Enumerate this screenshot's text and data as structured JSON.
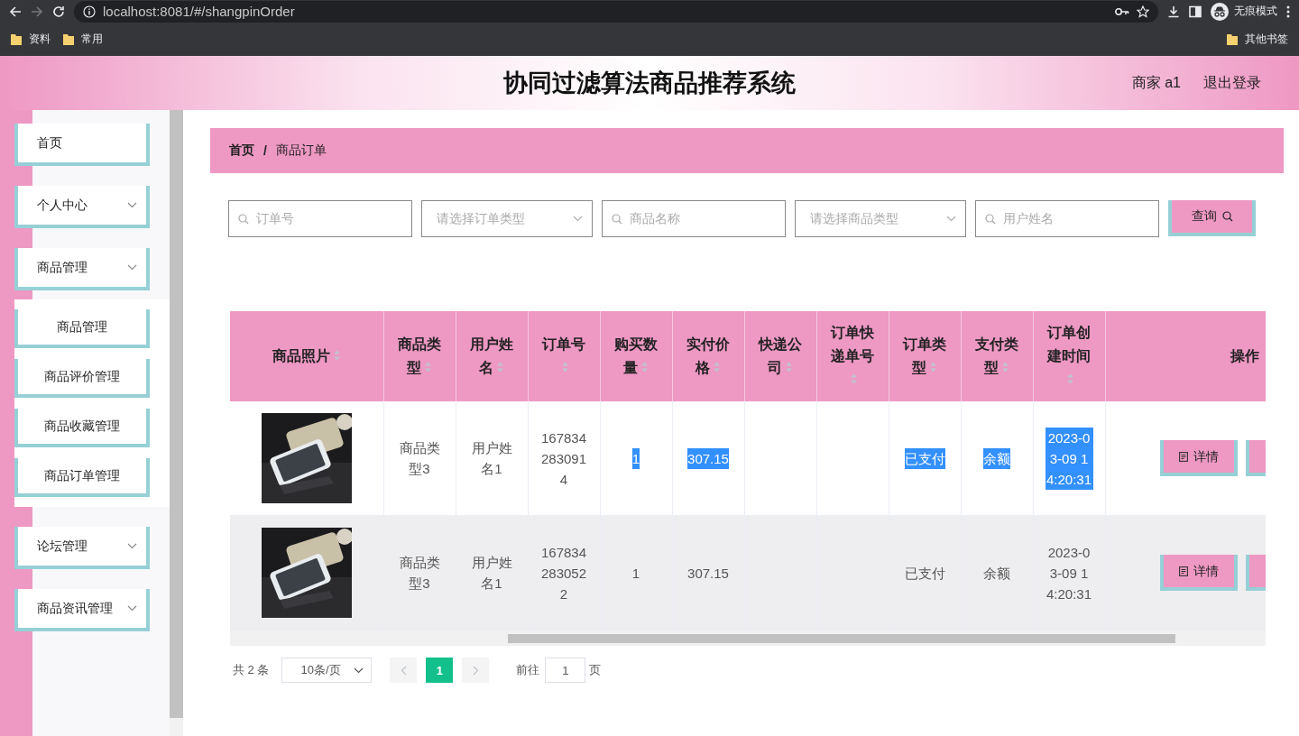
{
  "browser": {
    "url": "localhost:8081/#/shangpinOrder",
    "bookmarks": [
      "资料",
      "常用"
    ],
    "other_bookmarks": "其他书签",
    "profile": "无痕模式"
  },
  "header": {
    "title": "协同过滤算法商品推荐系统",
    "user": "商家 a1",
    "logout": "退出登录"
  },
  "sidebar": {
    "items": [
      {
        "kind": "link",
        "label": "首页"
      },
      {
        "kind": "submenu",
        "label": "个人中心"
      },
      {
        "kind": "submenu",
        "label": "商品管理",
        "children": [
          {
            "label": "商品管理"
          },
          {
            "label": "商品评价管理"
          },
          {
            "label": "商品收藏管理"
          },
          {
            "label": "商品订单管理"
          }
        ]
      },
      {
        "kind": "submenu",
        "label": "论坛管理"
      },
      {
        "kind": "submenu",
        "label": "商品资讯管理"
      }
    ]
  },
  "breadcrumb": {
    "items": [
      "首页",
      "商品订单"
    ],
    "separator": "/"
  },
  "filters": [
    {
      "kind": "search",
      "placeholder": "订单号"
    },
    {
      "kind": "select",
      "placeholder": "请选择订单类型"
    },
    {
      "kind": "search",
      "placeholder": "商品名称"
    },
    {
      "kind": "select",
      "placeholder": "请选择商品类型"
    },
    {
      "kind": "search",
      "placeholder": "用户姓名"
    }
  ],
  "search_button": "查询",
  "table": {
    "columns": [
      {
        "label": "商品照片",
        "sortable": true
      },
      {
        "label": "商品类型",
        "sortable": true
      },
      {
        "label": "用户姓名",
        "sortable": true
      },
      {
        "label": "订单号",
        "sortable": true
      },
      {
        "label": "购买数量",
        "sortable": true
      },
      {
        "label": "实付价格",
        "sortable": true
      },
      {
        "label": "快递公司",
        "sortable": true
      },
      {
        "label": "订单快递单号",
        "sortable": true
      },
      {
        "label": "订单类型",
        "sortable": true
      },
      {
        "label": "支付类型",
        "sortable": true
      },
      {
        "label": "订单创建时间",
        "sortable": true
      },
      {
        "label": "操作",
        "sortable": false
      }
    ],
    "rows": [
      {
        "hovered": false,
        "cells": [
          {
            "kind": "picture"
          },
          {
            "text": "商品类型3",
            "highlighted": false
          },
          {
            "text": "用户姓名1",
            "highlighted": false
          },
          {
            "text": "1678342830914",
            "highlighted": false
          },
          {
            "text": "1",
            "highlighted": true
          },
          {
            "text": "307.15",
            "highlighted": true
          },
          {
            "kind": "empty"
          },
          {
            "kind": "empty"
          },
          {
            "text": "已支付",
            "highlighted": true
          },
          {
            "text": "余额",
            "highlighted": true
          },
          {
            "text": "2023-03-09 14:20:31",
            "highlighted": true
          }
        ],
        "actions": [
          {
            "kind": "button",
            "label": "详情"
          },
          {
            "kind": "clipped"
          }
        ]
      },
      {
        "hovered": true,
        "cells": [
          {
            "kind": "picture"
          },
          {
            "text": "商品类型3",
            "highlighted": false
          },
          {
            "text": "用户姓名1",
            "highlighted": false
          },
          {
            "text": "1678342830522",
            "highlighted": false
          },
          {
            "text": "1",
            "highlighted": false
          },
          {
            "text": "307.15",
            "highlighted": false
          },
          {
            "kind": "empty"
          },
          {
            "kind": "empty"
          },
          {
            "text": "已支付",
            "highlighted": false
          },
          {
            "text": "余额",
            "highlighted": false
          },
          {
            "text": "2023-03-09 14:20:31",
            "highlighted": false
          }
        ],
        "actions": [
          {
            "kind": "button",
            "label": "详情"
          },
          {
            "kind": "clipped"
          }
        ]
      }
    ]
  },
  "pagination": {
    "total": "共 2 条",
    "page_size": "10条/页",
    "prev_disabled": true,
    "pages": [
      {
        "label": "1",
        "selected": true
      }
    ],
    "next_disabled": true,
    "goto_label": "前往",
    "goto_value": "1",
    "page_unit": "页"
  }
}
